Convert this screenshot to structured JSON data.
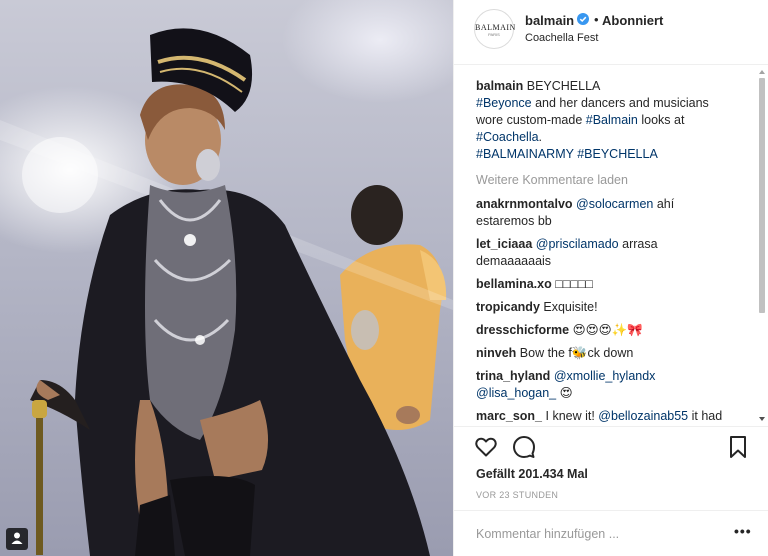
{
  "post": {
    "author": "balmain",
    "follow_status": "Abonniert",
    "location": "Coachella Fest",
    "avatar_text": "BALMAIN",
    "avatar_subtext": "PARIS"
  },
  "caption": {
    "username": "balmain",
    "lines": [
      [
        {
          "t": "BEYCHELLA",
          "k": "text"
        }
      ],
      [
        {
          "t": "#Beyonce",
          "k": "tag"
        },
        {
          "t": " and her dancers and musicians",
          "k": "text"
        }
      ],
      [
        {
          "t": "wore custom-made ",
          "k": "text"
        },
        {
          "t": "#Balmain",
          "k": "tag"
        },
        {
          "t": " looks at",
          "k": "text"
        }
      ],
      [
        {
          "t": "#Coachella",
          "k": "tag"
        },
        {
          "t": ".",
          "k": "text"
        }
      ],
      [
        {
          "t": "#BALMAINARMY",
          "k": "tag"
        },
        {
          "t": " ",
          "k": "text"
        },
        {
          "t": "#BEYCHELLA",
          "k": "tag"
        }
      ]
    ]
  },
  "load_more": "Weitere Kommentare laden",
  "comments": [
    {
      "user": "anakrnmontalvo",
      "lines": [
        [
          {
            "t": "@solocarmen",
            "k": "tag"
          },
          {
            "t": " ahí",
            "k": "text"
          }
        ],
        [
          {
            "t": "estaremos bb",
            "k": "text"
          }
        ]
      ]
    },
    {
      "user": "let_iciaaa",
      "lines": [
        [
          {
            "t": "@priscilamado",
            "k": "tag"
          },
          {
            "t": " arrasa",
            "k": "text"
          }
        ],
        [
          {
            "t": "demaaaaaais",
            "k": "text"
          }
        ]
      ]
    },
    {
      "user": "bellamina.xo",
      "lines": [
        [
          {
            "t": "□□□□□",
            "k": "text"
          }
        ]
      ]
    },
    {
      "user": "tropicandy",
      "lines": [
        [
          {
            "t": "Exquisite!",
            "k": "text"
          }
        ]
      ]
    },
    {
      "user": "dresschicforme",
      "lines": [
        [
          {
            "t": "😍😍😍✨🎀",
            "k": "text"
          }
        ]
      ]
    },
    {
      "user": "ninveh",
      "lines": [
        [
          {
            "t": "Bow the f🐝ck down",
            "k": "text"
          }
        ]
      ]
    },
    {
      "user": "trina_hyland",
      "lines": [
        [
          {
            "t": "@xmollie_hylandx",
            "k": "tag"
          }
        ],
        [
          {
            "t": "@lisa_hogan_",
            "k": "tag"
          },
          {
            "t": " 😍",
            "k": "text"
          }
        ]
      ]
    },
    {
      "user": "marc_son_",
      "lines": [
        [
          {
            "t": "I knew it! ",
            "k": "text"
          },
          {
            "t": "@bellozainab55",
            "k": "tag"
          },
          {
            "t": " it had",
            "k": "text"
          }
        ]
      ]
    }
  ],
  "likes_text": "Gefällt 201.434 Mal",
  "timestamp": "VOR 23 STUNDEN",
  "comment_input": {
    "value": "",
    "placeholder": "Kommentar hinzufügen ..."
  },
  "more_options": "•••",
  "icons": {
    "like": "heart-icon",
    "comment": "comment-bubble-icon",
    "save": "bookmark-icon",
    "verified": "verified-badge-icon",
    "user_tag": "user-tag-icon"
  },
  "colors": {
    "link": "#003569",
    "verified": "#3897f0",
    "muted": "#999999"
  }
}
